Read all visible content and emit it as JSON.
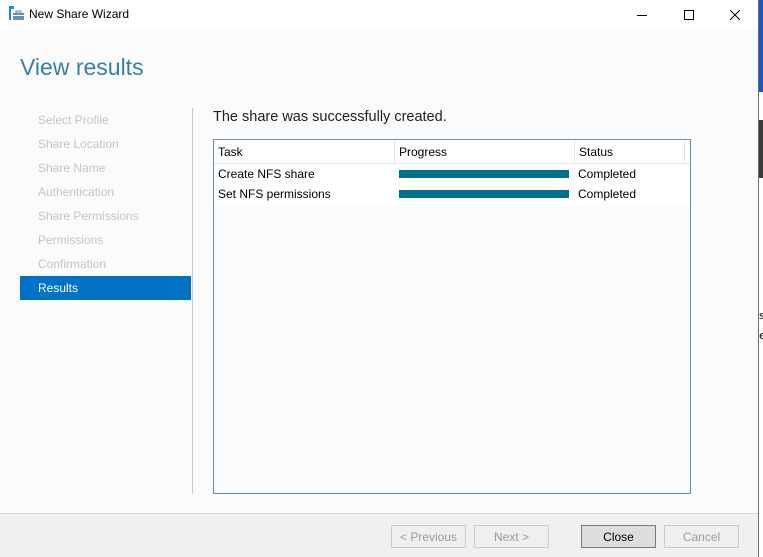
{
  "window": {
    "title": "New Share Wizard",
    "controls": {
      "minimize": "minimize-icon",
      "maximize": "maximize-icon",
      "close": "close-icon"
    },
    "app_icon": "share-wizard-icon"
  },
  "page": {
    "title": "View results",
    "message": "The share was successfully created."
  },
  "nav": {
    "items": [
      {
        "label": "Select Profile",
        "active": false
      },
      {
        "label": "Share Location",
        "active": false
      },
      {
        "label": "Share Name",
        "active": false
      },
      {
        "label": "Authentication",
        "active": false
      },
      {
        "label": "Share Permissions",
        "active": false
      },
      {
        "label": "Permissions",
        "active": false
      },
      {
        "label": "Confirmation",
        "active": false
      },
      {
        "label": "Results",
        "active": true
      }
    ]
  },
  "results_table": {
    "columns": [
      "Task",
      "Progress",
      "Status"
    ],
    "rows": [
      {
        "task": "Create NFS share",
        "progress": 1.0,
        "status": "Completed"
      },
      {
        "task": "Set NFS permissions",
        "progress": 1.0,
        "status": "Completed"
      }
    ]
  },
  "footer": {
    "previous": "< Previous",
    "next": "Next >",
    "close": "Close",
    "cancel": "Cancel"
  },
  "background_window": {
    "fragments": [
      "s",
      "e"
    ]
  },
  "colors": {
    "accent": "#0072c6",
    "progress": "#00708f",
    "title": "#3a7fa8"
  }
}
